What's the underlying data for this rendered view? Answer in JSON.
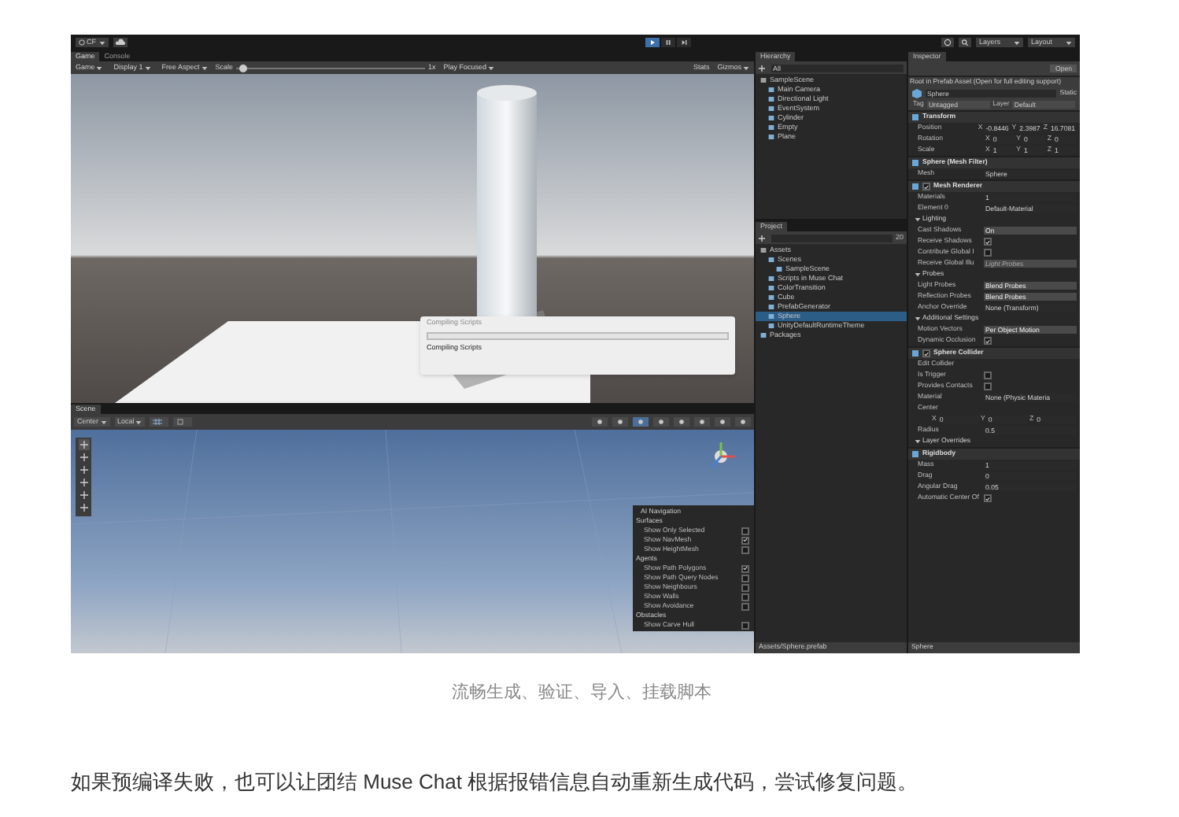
{
  "toolbar": {
    "account": "CF",
    "layers": "Layers",
    "layout": "Layout"
  },
  "game_panel": {
    "tabs": [
      {
        "label": "Game",
        "selected": true
      },
      {
        "label": "Console",
        "selected": false
      }
    ],
    "toolbar": [
      {
        "kind": "dropdown",
        "label": "Game"
      },
      {
        "kind": "dropdown",
        "label": "Display 1"
      },
      {
        "kind": "dropdown",
        "label": "Free Aspect"
      },
      {
        "kind": "slider",
        "label": "Scale",
        "value": "1x",
        "level": 0.03
      },
      {
        "kind": "dropdown",
        "label": "Play Focused"
      },
      {
        "kind": "text",
        "label": "Stats"
      },
      {
        "kind": "dropdown",
        "label": "Gizmos"
      }
    ],
    "dialog": {
      "title": "Compiling Scripts",
      "status": "Compiling Scripts",
      "level": 0
    }
  },
  "scene_panel": {
    "tab": "Scene",
    "toolbar": [
      "Center",
      "Local"
    ],
    "overlay": {
      "title": "AI Navigation",
      "sections": [
        {
          "title": "Surfaces",
          "items": [
            {
              "label": "Show Only Selected",
              "checked": false
            },
            {
              "label": "Show NavMesh",
              "checked": true
            },
            {
              "label": "Show HeightMesh",
              "checked": false
            }
          ]
        },
        {
          "title": "Agents",
          "items": [
            {
              "label": "Show Path Polygons",
              "checked": true
            },
            {
              "label": "Show Path Query Nodes",
              "checked": false
            },
            {
              "label": "Show Neighbours",
              "checked": false
            },
            {
              "label": "Show Walls",
              "checked": false
            },
            {
              "label": "Show Avoidance",
              "checked": false
            }
          ]
        },
        {
          "title": "Obstacles",
          "items": [
            {
              "label": "Show Carve Hull",
              "checked": false
            }
          ]
        }
      ]
    }
  },
  "hierarchy": {
    "title": "Hierarchy",
    "search": "All",
    "tree": [
      {
        "label": "SampleScene",
        "children": [
          {
            "label": "Main Camera"
          },
          {
            "label": "Directional Light"
          },
          {
            "label": "EventSystem"
          },
          {
            "label": "Cylinder"
          },
          {
            "label": "Empty"
          },
          {
            "label": "Plane"
          }
        ]
      }
    ]
  },
  "project": {
    "title": "Project",
    "count": "20",
    "tree": [
      {
        "label": "Assets",
        "selected": false,
        "children": [
          {
            "label": "Scenes",
            "selected": false,
            "children": [
              {
                "label": "SampleScene",
                "selected": false
              }
            ]
          },
          {
            "label": "Scripts in Muse Chat",
            "selected": false
          },
          {
            "label": "ColorTransition",
            "selected": false
          },
          {
            "label": "Cube",
            "selected": false
          },
          {
            "label": "PrefabGenerator",
            "selected": false
          },
          {
            "label": "Sphere",
            "selected": true
          },
          {
            "label": "UnityDefaultRuntimeTheme",
            "selected": false
          }
        ]
      },
      {
        "label": "Packages",
        "selected": false
      }
    ],
    "footer": "Assets/Sphere.prefab"
  },
  "inspector": {
    "title": "Inspector",
    "open_button": "Open",
    "note": "Root in Prefab Asset (Open for full editing support)",
    "name": "Sphere",
    "static": "Static",
    "tag_label": "Tag",
    "tag": "Untagged",
    "layer_label": "Layer",
    "layer": "Default",
    "components": [
      {
        "name": "Transform",
        "rows": [
          {
            "kind": "xyz",
            "label": "Position",
            "values": [
              {
                "axis": "X",
                "value": "-0.8446"
              },
              {
                "axis": "Y",
                "value": "2.3987"
              },
              {
                "axis": "Z",
                "value": "16.7081"
              }
            ]
          },
          {
            "kind": "xyz",
            "label": "Rotation",
            "values": [
              {
                "axis": "X",
                "value": "0"
              },
              {
                "axis": "Y",
                "value": "0"
              },
              {
                "axis": "Z",
                "value": "0"
              }
            ]
          },
          {
            "kind": "xyz",
            "label": "Scale",
            "values": [
              {
                "axis": "X",
                "value": "1"
              },
              {
                "axis": "Y",
                "value": "1"
              },
              {
                "axis": "Z",
                "value": "1"
              }
            ]
          }
        ]
      },
      {
        "name": "Sphere (Mesh Filter)",
        "rows": [
          {
            "kind": "field",
            "label": "Mesh",
            "value": "Sphere"
          }
        ]
      },
      {
        "name": "Mesh Renderer",
        "enabled": true,
        "rows": [
          {
            "kind": "field",
            "label": "Materials",
            "value": "1"
          },
          {
            "kind": "field",
            "label": "Element 0",
            "value": "Default-Material"
          },
          {
            "kind": "section",
            "label": "Lighting"
          },
          {
            "kind": "dropdown",
            "label": "Cast Shadows",
            "value": "On",
            "disabled": false
          },
          {
            "kind": "check",
            "label": "Receive Shadows",
            "checked": true
          },
          {
            "kind": "check",
            "label": "Contribute Global I",
            "checked": false
          },
          {
            "kind": "dropdown",
            "label": "Receive Global Illu",
            "value": "Light Probes",
            "disabled": true
          },
          {
            "kind": "section",
            "label": "Probes"
          },
          {
            "kind": "dropdown",
            "label": "Light Probes",
            "value": "Blend Probes",
            "disabled": false
          },
          {
            "kind": "dropdown",
            "label": "Reflection Probes",
            "value": "Blend Probes",
            "disabled": false
          },
          {
            "kind": "field",
            "label": "Anchor Override",
            "value": "None (Transform)"
          },
          {
            "kind": "section",
            "label": "Additional Settings"
          },
          {
            "kind": "dropdown",
            "label": "Motion Vectors",
            "value": "Per Object Motion",
            "disabled": false
          },
          {
            "kind": "check",
            "label": "Dynamic Occlusion",
            "checked": true
          }
        ]
      },
      {
        "name": "Sphere Collider",
        "enabled": true,
        "rows": [
          {
            "kind": "text",
            "label": "Edit Collider"
          },
          {
            "kind": "check",
            "label": "Is Trigger",
            "checked": false
          },
          {
            "kind": "check",
            "label": "Provides Contacts",
            "checked": false
          },
          {
            "kind": "field",
            "label": "Material",
            "value": "None (Physic Materia"
          },
          {
            "kind": "text",
            "label": "Center"
          },
          {
            "kind": "xyz",
            "label": "",
            "values": [
              {
                "axis": "X",
                "value": "0"
              },
              {
                "axis": "Y",
                "value": "0"
              },
              {
                "axis": "Z",
                "value": "0"
              }
            ]
          },
          {
            "kind": "field",
            "label": "Radius",
            "value": "0.5"
          },
          {
            "kind": "section",
            "label": "Layer Overrides"
          }
        ]
      },
      {
        "name": "Rigidbody",
        "rows": [
          {
            "kind": "field",
            "label": "Mass",
            "value": "1"
          },
          {
            "kind": "field",
            "label": "Drag",
            "value": "0"
          },
          {
            "kind": "field",
            "label": "Angular Drag",
            "value": "0.05"
          },
          {
            "kind": "check",
            "label": "Automatic Center Of",
            "checked": true
          }
        ]
      }
    ],
    "footer": "Sphere"
  },
  "caption": "流畅生成、验证、导入、挂载脚本",
  "paragraph": "如果预编译失败，也可以让团结 Muse Chat 根据报错信息自动重新生成代码，尝试修复问题。"
}
